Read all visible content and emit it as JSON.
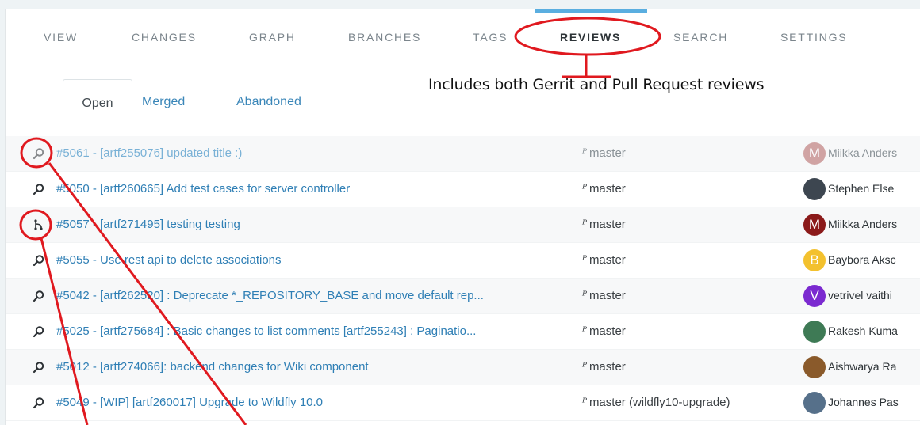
{
  "topnav": {
    "items": [
      {
        "label": "VIEW"
      },
      {
        "label": "CHANGES"
      },
      {
        "label": "GRAPH"
      },
      {
        "label": "BRANCHES"
      },
      {
        "label": "TAGS"
      },
      {
        "label": "REVIEWS"
      },
      {
        "label": "SEARCH"
      },
      {
        "label": "SETTINGS"
      }
    ],
    "active": "REVIEWS",
    "accent_color": "#5aaee0"
  },
  "subtabs": {
    "items": [
      {
        "label": "Open"
      },
      {
        "label": "Merged"
      },
      {
        "label": "Abandoned"
      }
    ],
    "active": "Open"
  },
  "annotation": {
    "note": "Includes both Gerrit and Pull Request reviews",
    "color": "#e0191f"
  },
  "reviews": [
    {
      "icon": "search-icon",
      "title": "#5061 - [artf255076] updated title :)",
      "branch": "master",
      "author": "Miikka Anders",
      "avatar_letter": "M",
      "avatar_color": "#c08080"
    },
    {
      "icon": "search-icon",
      "title": "#5050 - [artf260665] Add test cases for server controller",
      "branch": "master",
      "author": "Stephen Else",
      "avatar_letter": "",
      "avatar_color": "#3d4650"
    },
    {
      "icon": "git-pull-request-icon",
      "title": "#5057 - [artf271495] testing testing",
      "branch": "master",
      "author": "Miikka Anders",
      "avatar_letter": "M",
      "avatar_color": "#8b1a1a"
    },
    {
      "icon": "search-icon",
      "title": "#5055 - Use rest api to delete associations",
      "branch": "master",
      "author": "Baybora Aksc",
      "avatar_letter": "B",
      "avatar_color": "#f3c12e"
    },
    {
      "icon": "search-icon",
      "title": "#5042 - [artf262520] : Deprecate *_REPOSITORY_BASE and move default rep...",
      "branch": "master",
      "author": "vetrivel vaithi",
      "avatar_letter": "V",
      "avatar_color": "#7b2ad0"
    },
    {
      "icon": "search-icon",
      "title": "#5025 - [artf275684] : Basic changes to list comments [artf255243] : Paginatio...",
      "branch": "master",
      "author": "Rakesh Kuma",
      "avatar_letter": "",
      "avatar_color": "#3e7a55"
    },
    {
      "icon": "search-icon",
      "title": "#5012 - [artf274066]: backend changes for Wiki component",
      "branch": "master",
      "author": "Aishwarya Ra",
      "avatar_letter": "",
      "avatar_color": "#8a5a2b"
    },
    {
      "icon": "search-icon",
      "title": "#5049 - [WIP] [artf260017] Upgrade to Wildfly 10.0",
      "branch": "master (wildfly10-upgrade)",
      "author": "Johannes Pas",
      "avatar_letter": "",
      "avatar_color": "#56708a"
    }
  ]
}
